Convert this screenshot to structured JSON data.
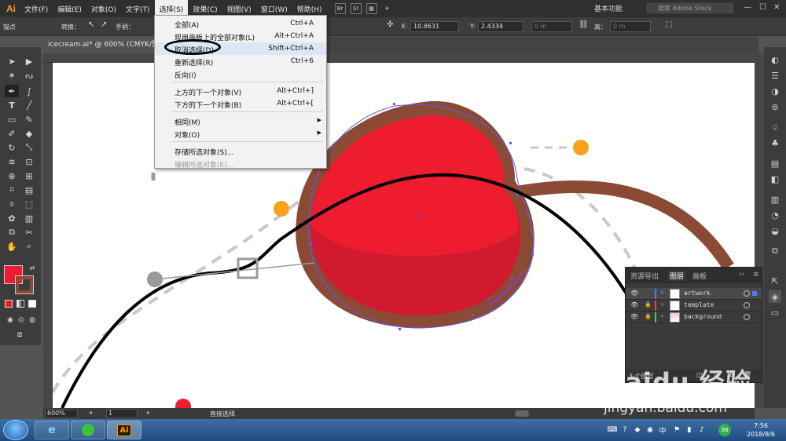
{
  "app": {
    "logo": "Ai",
    "menus": [
      "文件(F)",
      "编辑(E)",
      "对象(O)",
      "文字(T)",
      "选择(S)",
      "效果(C)",
      "视图(V)",
      "窗口(W)",
      "帮助(H)"
    ],
    "mini_buttons": [
      "Br",
      "St"
    ],
    "workspace": "基本功能",
    "stock_search_placeholder": "搜索 Adobe Stock"
  },
  "control_bar": {
    "anchor_label": "锚点",
    "convert_label": "转换：",
    "handle_label": "手柄：",
    "x_label": "X:",
    "x_value": "10.8631",
    "y_label": "Y:",
    "y_value": "2.4334",
    "w_value": "0 m",
    "h_label": "高：",
    "h_value": "0 m"
  },
  "document": {
    "tab_title": "icecream.ai* @ 600% (CMYK/预"
  },
  "select_menu": {
    "items": [
      {
        "label": "全部(A)",
        "shortcut": "Ctrl+A"
      },
      {
        "label": "现用画板上的全部对象(L)",
        "shortcut": "Alt+Ctrl+A"
      },
      {
        "label": "取消选择(D)",
        "shortcut": "Shift+Ctrl+A"
      },
      {
        "label": "重新选择(R)",
        "shortcut": "Ctrl+6"
      },
      {
        "label": "反向(I)",
        "shortcut": ""
      },
      {
        "label": "上方的下一个对象(V)",
        "shortcut": "Alt+Ctrl+]"
      },
      {
        "label": "下方的下一个对象(B)",
        "shortcut": "Alt+Ctrl+["
      },
      {
        "label": "相同(M)",
        "shortcut": ""
      },
      {
        "label": "对象(O)",
        "shortcut": ""
      },
      {
        "label": "存储所选对象(S)...",
        "shortcut": ""
      },
      {
        "label": "编辑所选对象(E)...",
        "shortcut": ""
      }
    ]
  },
  "layers_panel": {
    "tabs": [
      "资源导出",
      "图层",
      "画板"
    ],
    "layers": [
      {
        "name": "artwork",
        "color": "#4f7cff"
      },
      {
        "name": "template",
        "color": "#ff3b3b"
      },
      {
        "name": "background",
        "color": "#3bd14a"
      }
    ],
    "footer": "3 个图层"
  },
  "status_bar": {
    "zoom": "600%",
    "page": "1",
    "tool": "直接选择"
  },
  "taskbar": {
    "ai_label": "Ai",
    "time": "7:56",
    "date": "2018/8/6",
    "badge": "38"
  },
  "watermark": {
    "brand": "Baidu 经验",
    "url": "jingyan.baidu.com"
  },
  "colors": {
    "fill_red": "#ed1c2e",
    "stroke_brown": "#8b4a34",
    "accent_orange": "#f7a21b"
  }
}
